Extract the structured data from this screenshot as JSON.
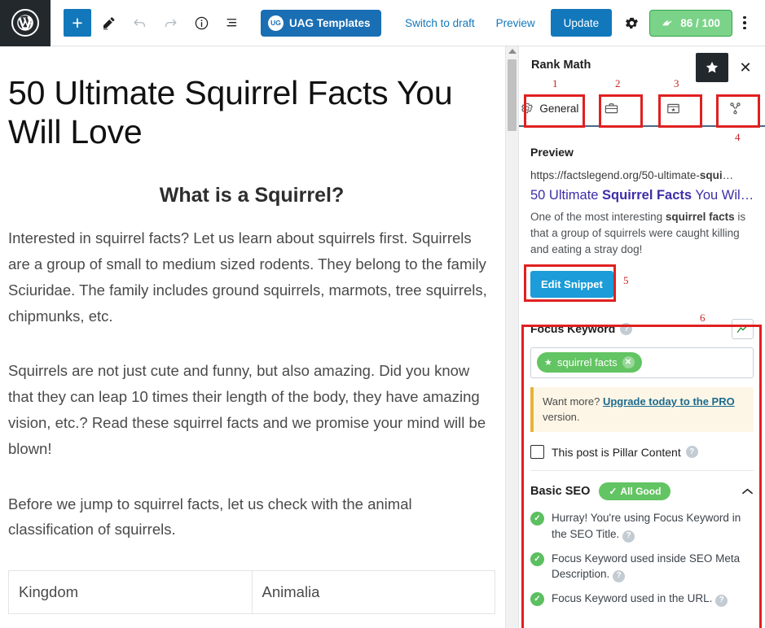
{
  "topbar": {
    "wp_logo": "W",
    "add_label": "+",
    "uag_badge": "UG",
    "uag_label": "UAG Templates",
    "switch_to_draft": "Switch to draft",
    "preview": "Preview",
    "update": "Update",
    "seo_score": "86 / 100",
    "icons": {
      "pencil": "edit-pencil-icon",
      "undo": "undo-icon",
      "redo": "redo-icon",
      "info": "info-icon",
      "list_view": "list-view-icon",
      "gear": "settings-gear-icon",
      "kebab": "more-options-icon"
    }
  },
  "editor": {
    "title": "50 Ultimate Squirrel Facts You Will Love",
    "heading2": "What is a Squirrel?",
    "paragraph1": "Interested in squirrel facts? Let us learn about squirrels first. Squirrels are a group of small to medium sized rodents. They belong to the family Sciuridae. The family includes ground squirrels, marmots, tree squirrels, chipmunks, etc.",
    "paragraph2": "Squirrels are not just cute and funny, but also amazing. Did you know that they can leap 10 times their length of the body, they have amazing vision, etc.? Read these squirrel facts and we promise your mind will be blown!",
    "paragraph3": "Before we jump to squirrel facts, let us check with the animal classification of squirrels.",
    "table_rows": [
      {
        "term": "Kingdom",
        "value": "Animalia"
      }
    ]
  },
  "panel": {
    "title": "Rank Math",
    "star_icon": "★",
    "close_icon": "✕",
    "tabs": [
      {
        "label": "General",
        "icon": "gear-icon",
        "active": true
      },
      {
        "label": "",
        "icon": "briefcase-icon",
        "active": false
      },
      {
        "label": "",
        "icon": "social-card-icon",
        "active": false
      },
      {
        "label": "",
        "icon": "share-nodes-icon",
        "active": false
      }
    ],
    "preview": {
      "section_label": "Preview",
      "url_plain": "https://factslegend.org/50-ultimate-",
      "url_bold": "squi",
      "url_ellipsis": "…",
      "title_pre": "50 Ultimate ",
      "title_bold": "Squirrel Facts",
      "title_post": " You Wil",
      "title_ellipsis": "…",
      "desc_pre": "One of the most interesting ",
      "desc_bold": "squirrel facts",
      "desc_post": " is that a group of squirrels were caught killing and eating a stray dog!",
      "edit_snippet_label": "Edit Snippet"
    },
    "focus_keyword": {
      "label": "Focus Keyword",
      "help": "?",
      "trend_icon": "trend-chart-icon",
      "chip_text": "squirrel facts",
      "chip_star": "★",
      "chip_remove": "✕",
      "notice_pre": "Want more? ",
      "notice_link": "Upgrade today to the PRO",
      "notice_post": " version."
    },
    "pillar": {
      "label": "This post is Pillar Content",
      "help": "?",
      "checked": false
    },
    "basic_seo": {
      "title": "Basic SEO",
      "badge": "All Good",
      "badge_check": "✓",
      "collapse_icon": "chevron-up-icon",
      "items": [
        {
          "status": "pass",
          "text": "Hurray! You're using Focus Keyword in the SEO Title."
        },
        {
          "status": "pass",
          "text": "Focus Keyword used inside SEO Meta Description."
        },
        {
          "status": "pass",
          "text": "Focus Keyword used in the URL."
        }
      ]
    }
  },
  "annotations": {
    "numbers": [
      "1",
      "2",
      "3",
      "4",
      "5",
      "6"
    ],
    "color": "#e02020"
  }
}
